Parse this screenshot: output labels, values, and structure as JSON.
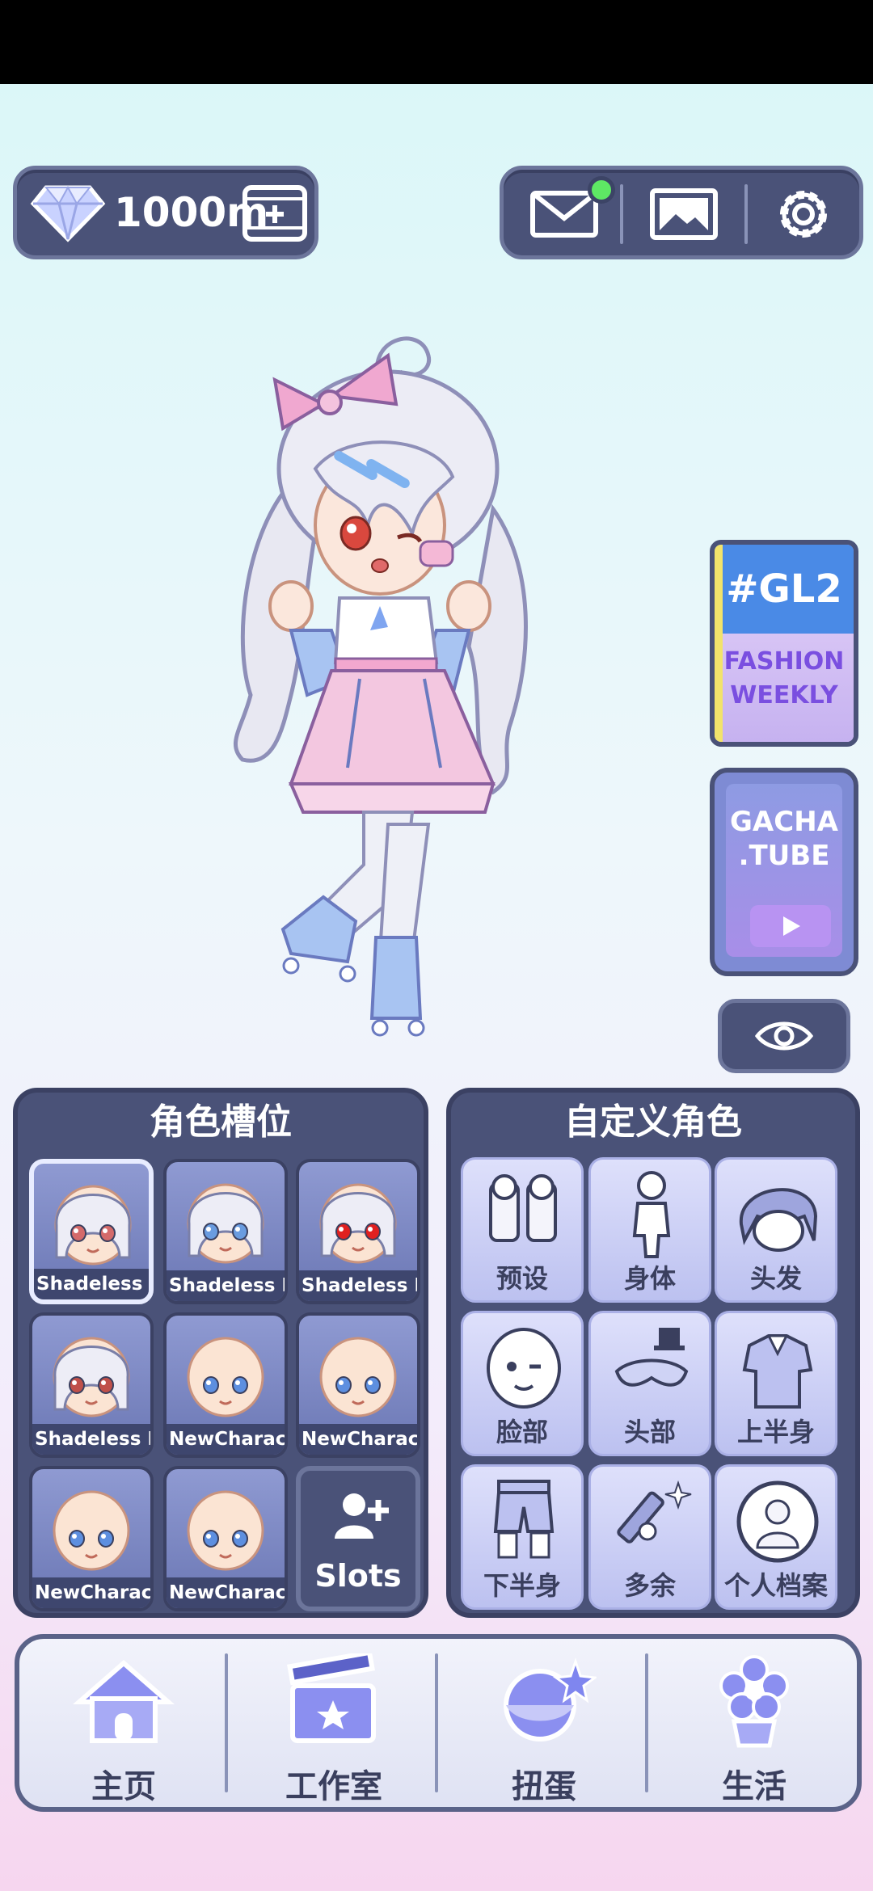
{
  "top_bar": {
    "currency_amount": "1000m",
    "icons": [
      "gem-icon",
      "add-currency-icon",
      "mail-icon",
      "gallery-icon",
      "settings-icon"
    ],
    "mail_has_notification": true
  },
  "side_cards": {
    "gl2_line1": "#GL2",
    "gl2_line2": "FASHION",
    "gl2_line3": "WEEKLY",
    "gacha_line1": "GACHA",
    "gacha_line2": ".TUBE"
  },
  "character_slots": {
    "title": "角色槽位",
    "slots": [
      {
        "name": "Shadeless Bas",
        "eye_color": "#d46a6a",
        "hair": "white",
        "selected": true
      },
      {
        "name": "Shadeless Bas",
        "eye_color": "#6a9ce0",
        "hair": "white",
        "selected": false
      },
      {
        "name": "Shadeless Bas",
        "eye_color": "#e02020",
        "hair": "white",
        "selected": false
      },
      {
        "name": "Shadeless Bas",
        "eye_color": "#c0504a",
        "hair": "white",
        "selected": false
      },
      {
        "name": "NewCharacter",
        "eye_color": "#5d8fe0",
        "hair": "none",
        "selected": false
      },
      {
        "name": "NewCharacter",
        "eye_color": "#5d8fe0",
        "hair": "none",
        "selected": false
      },
      {
        "name": "NewCharacter",
        "eye_color": "#5d8fe0",
        "hair": "none",
        "selected": false
      },
      {
        "name": "NewCharacter",
        "eye_color": "#5d8fe0",
        "hair": "none",
        "selected": false
      }
    ],
    "add_slot_label": "Slots"
  },
  "customize": {
    "title": "自定义角色",
    "categories": [
      {
        "label": "预设",
        "icon": "preset-icon"
      },
      {
        "label": "身体",
        "icon": "body-icon"
      },
      {
        "label": "头发",
        "icon": "hair-icon"
      },
      {
        "label": "脸部",
        "icon": "face-icon"
      },
      {
        "label": "头部",
        "icon": "head-accessory-icon"
      },
      {
        "label": "上半身",
        "icon": "upper-body-icon"
      },
      {
        "label": "下半身",
        "icon": "lower-body-icon"
      },
      {
        "label": "多余",
        "icon": "extra-icon"
      },
      {
        "label": "个人档案",
        "icon": "profile-icon"
      }
    ]
  },
  "bottom_nav": {
    "items": [
      {
        "label": "主页",
        "icon": "home-icon"
      },
      {
        "label": "工作室",
        "icon": "studio-icon"
      },
      {
        "label": "扭蛋",
        "icon": "gacha-icon"
      },
      {
        "label": "生活",
        "icon": "life-icon"
      }
    ]
  },
  "colors": {
    "panel": "#4a5278",
    "panel_border": "#3b4163",
    "accent_green": "#5ee864",
    "card_light": "#dee0fb"
  }
}
